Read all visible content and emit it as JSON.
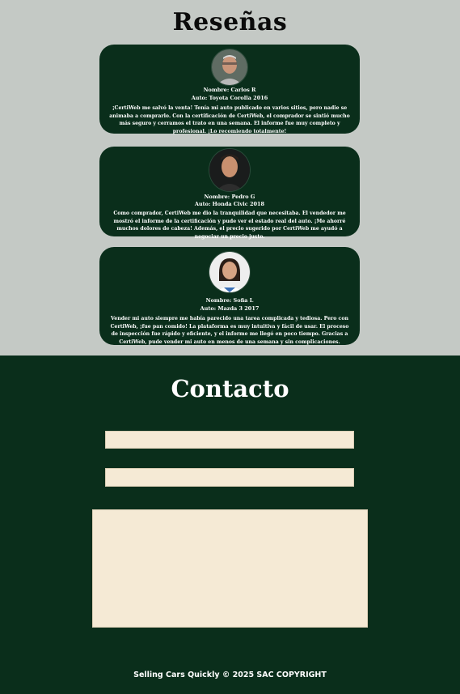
{
  "reviews": {
    "title": "Reseñas",
    "items": [
      {
        "name": "Nombre: Carlos R",
        "car": "Auto: Toyota Corolla 2016",
        "text": "¡CertiWeb me salvó la venta! Tenía mi auto publicado en varios sitios, pero nadie se animaba a comprarlo. Con la certificación de CertiWeb, el comprador se sintió mucho más seguro y cerramos el trato en una semana. El informe fue muy completo y profesional. ¡Lo recomiendo totalmente!",
        "avatar_icon": "person-photo-older-man"
      },
      {
        "name": "Nombre: Pedro G",
        "car": "Auto: Honda Civic 2018",
        "text": "Como comprador, CertiWeb me dio la tranquilidad que necesitaba. El vendedor me mostró el informe de la certificación y pude ver el estado real del auto. ¡Me ahorré muchos dolores de cabeza! Además, el precio sugerido por CertiWeb me ayudó a negociar un precio justo.",
        "avatar_icon": "person-photo-young-man"
      },
      {
        "name": "Nombre: Sofia L",
        "car": "Auto: Mazda 3 2017",
        "text": "Vender mi auto siempre me había parecido una tarea complicada y tediosa. Pero con CertiWeb, ¡fue pan comido! La plataforma es muy intuitiva y fácil de usar. El proceso de inspección fue rápido y eficiente, y el informe me llegó en poco tiempo. Gracias a CertiWeb, pude vender mi auto en menos de una semana y sin complicaciones.",
        "avatar_icon": "person-photo-woman"
      }
    ]
  },
  "contact": {
    "title": "Contacto",
    "field1_placeholder": "",
    "field2_placeholder": "",
    "message_placeholder": ""
  },
  "footer": {
    "text": "Selling Cars Quickly © 2025 SAC COPYRIGHT"
  },
  "colors": {
    "dark_green": "#0a2e1b",
    "light_gray": "#c4c9c5",
    "cream": "#f5ead5"
  }
}
